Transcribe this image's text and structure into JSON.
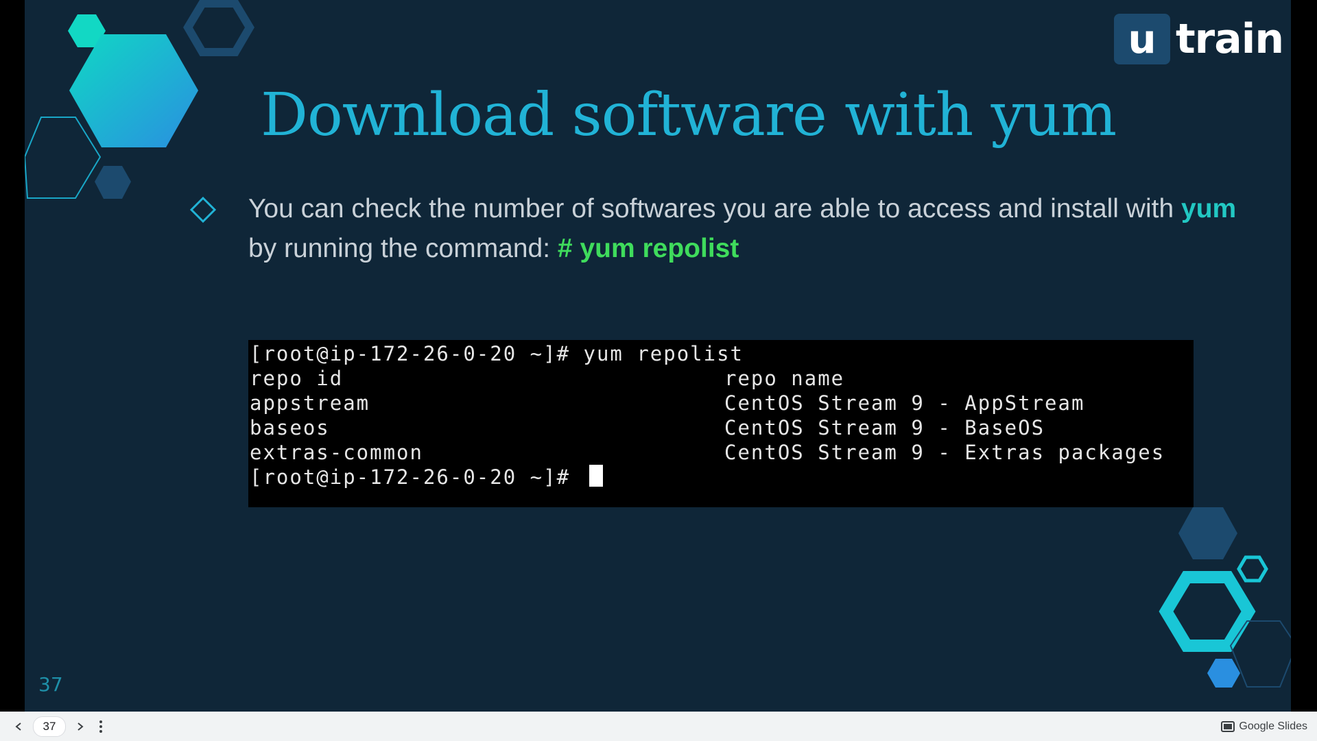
{
  "slide": {
    "logo": {
      "letter": "u",
      "word": "train"
    },
    "title": "Download software with yum",
    "bullet": {
      "part1": "You can check the number of softwares you are able to access and install with ",
      "keyword": "yum",
      "part2": " by running the command: ",
      "command": "# yum repolist"
    },
    "terminal": {
      "prompt_line": "[root@ip-172-26-0-20 ~]# yum repolist",
      "header": {
        "col1": "repo id",
        "col2": "repo name"
      },
      "rows": [
        {
          "id": "appstream",
          "name": "CentOS Stream 9 - AppStream"
        },
        {
          "id": "baseos",
          "name": "CentOS Stream 9 - BaseOS"
        },
        {
          "id": "extras-common",
          "name": "CentOS Stream 9 - Extras packages"
        }
      ],
      "final_prompt": "[root@ip-172-26-0-20 ~]# "
    },
    "slide_number": "37"
  },
  "toolbar": {
    "page_number": "37",
    "brand": "Google Slides"
  },
  "colors": {
    "background": "#0f2638",
    "title": "#21b3d6",
    "keyword": "#22c8c3",
    "command": "#3fdc5c"
  }
}
